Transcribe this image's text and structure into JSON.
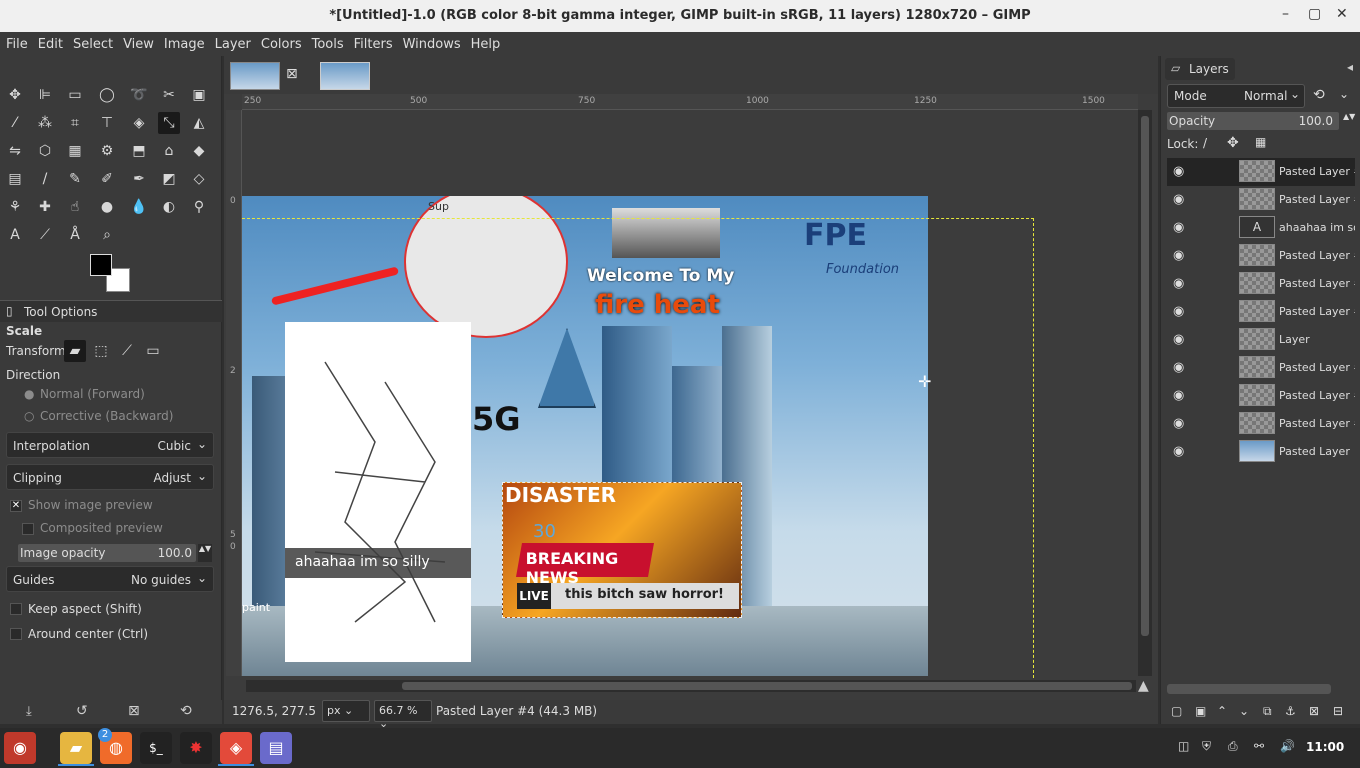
{
  "window": {
    "title": "*[Untitled]-1.0 (RGB color 8-bit gamma integer, GIMP built-in sRGB, 11 layers) 1280x720 – GIMP",
    "minimize": "–",
    "maximize": "▢",
    "close": "✕"
  },
  "menu": [
    "File",
    "Edit",
    "Select",
    "View",
    "Image",
    "Layer",
    "Colors",
    "Tools",
    "Filters",
    "Windows",
    "Help"
  ],
  "tool_options": {
    "header": "Tool Options",
    "tool": "Scale",
    "transform_label": "Transform:",
    "direction_label": "Direction",
    "direction_options": [
      "Normal (Forward)",
      "Corrective (Backward)"
    ],
    "interpolation_label": "Interpolation",
    "interpolation_value": "Cubic",
    "clipping_label": "Clipping",
    "clipping_value": "Adjust",
    "show_preview": "Show image preview",
    "composited_preview": "Composited preview",
    "image_opacity_label": "Image opacity",
    "image_opacity_value": "100.0",
    "guides_label": "Guides",
    "guides_value": "No guides",
    "keep_aspect": "Keep aspect (Shift)",
    "around_center": "Around center (Ctrl)"
  },
  "ruler": {
    "h": [
      "250",
      "500",
      "750",
      "1000",
      "1250",
      "1500"
    ],
    "v": [
      "0",
      "2",
      "5",
      "0"
    ]
  },
  "image_text": {
    "welcome": "Welcome To My",
    "fire": "fire heat",
    "fpe": "FPE",
    "foundation": "Foundation",
    "sup": "Sup",
    "g5": "5G",
    "silly": "ahaahaa im so silly",
    "disaster": "DISASTER",
    "breaking": "BREAKING NEWS",
    "live": "LIVE",
    "horror": "this bitch saw horror!",
    "paint": "paint",
    "count": "30"
  },
  "status": {
    "coords": "1276.5, 277.5",
    "unit": "px",
    "zoom": "66.7 %",
    "info": "Pasted Layer #4 (44.3 MB)"
  },
  "layers_panel": {
    "tab": "Layers",
    "mode_label": "Mode",
    "mode_value": "Normal",
    "opacity_label": "Opacity",
    "opacity_value": "100.0",
    "lock_label": "Lock:",
    "layers": [
      "Pasted Layer #",
      "Pasted Layer #",
      "ahaahaa im so",
      "Pasted Layer #",
      "Pasted Layer #",
      "Pasted Layer #",
      "Layer",
      "Pasted Layer #",
      "Pasted Layer #",
      "Pasted Layer #",
      "Pasted Layer"
    ]
  },
  "taskbar": {
    "badge": "2",
    "clock": "11:00"
  }
}
